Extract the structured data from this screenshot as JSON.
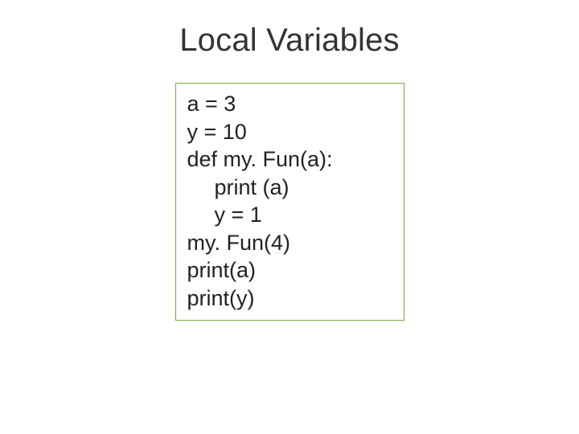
{
  "slide": {
    "title": "Local Variables",
    "code": {
      "l0": "a = 3",
      "l1": "y = 10",
      "l2": "def my. Fun(a):",
      "l3": "print (a)",
      "l4": "y = 1",
      "l5": "my. Fun(4)",
      "l6": "print(a)",
      "l7": "print(y)"
    }
  }
}
